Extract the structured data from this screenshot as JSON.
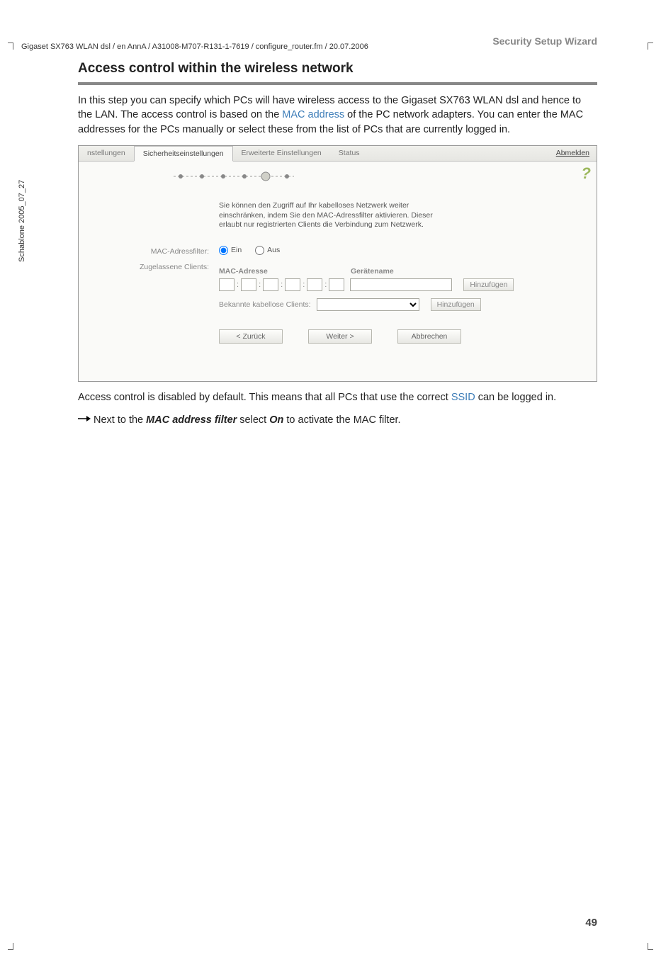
{
  "header_path": "Gigaset SX763 WLAN dsl / en AnnA / A31008-M707-R131-1-7619 / configure_router.fm / 20.07.2006",
  "vertical_label": "Schablone 2005_07_27",
  "breadcrumb": "Security Setup Wizard",
  "section_title": "Access control within the wireless network",
  "intro_text_1": "In this step you can specify which PCs will have wireless access to the Gigaset SX763 WLAN dsl and hence to the LAN. The access control is based on the ",
  "intro_link_1": "MAC address",
  "intro_text_2": " of the PC network adapters. You can enter the MAC addresses for the PCs manually or select these from the list of PCs that are currently logged in.",
  "screenshot": {
    "tabs": {
      "t1": "nstellungen",
      "t2": "Sicherheitseinstellungen",
      "t3": "Erweiterte Einstellungen",
      "t4": "Status"
    },
    "logout": "Abmelden",
    "help_icon": "?",
    "description": "Sie können den Zugriff auf Ihr kabelloses Netzwerk weiter einschränken, indem Sie den MAC-Adressfilter aktivieren. Dieser erlaubt nur registrierten Clients die Verbindung zum Netzwerk.",
    "mac_filter_label": "MAC-Adressfilter:",
    "radio_on": "Ein",
    "radio_off": "Aus",
    "allowed_clients_label": "Zugelassene Clients:",
    "col_mac": "MAC-Adresse",
    "col_name": "Gerätename",
    "add_btn": "Hinzufügen",
    "known_label": "Bekannte kabellose Clients:",
    "add_btn2": "Hinzufügen",
    "nav_back": "< Zurück",
    "nav_next": "Weiter >",
    "nav_cancel": "Abbrechen"
  },
  "post_text_1": "Access control is disabled by default. This means that all PCs that use the correct ",
  "post_link_1": "SSID",
  "post_text_2": " can be logged in.",
  "step_text_1a": "Next to the ",
  "step_text_1b": "MAC address filter",
  "step_text_1c": " select ",
  "step_text_1d": "On",
  "step_text_1e": " to activate the MAC filter.",
  "page_number": "49"
}
